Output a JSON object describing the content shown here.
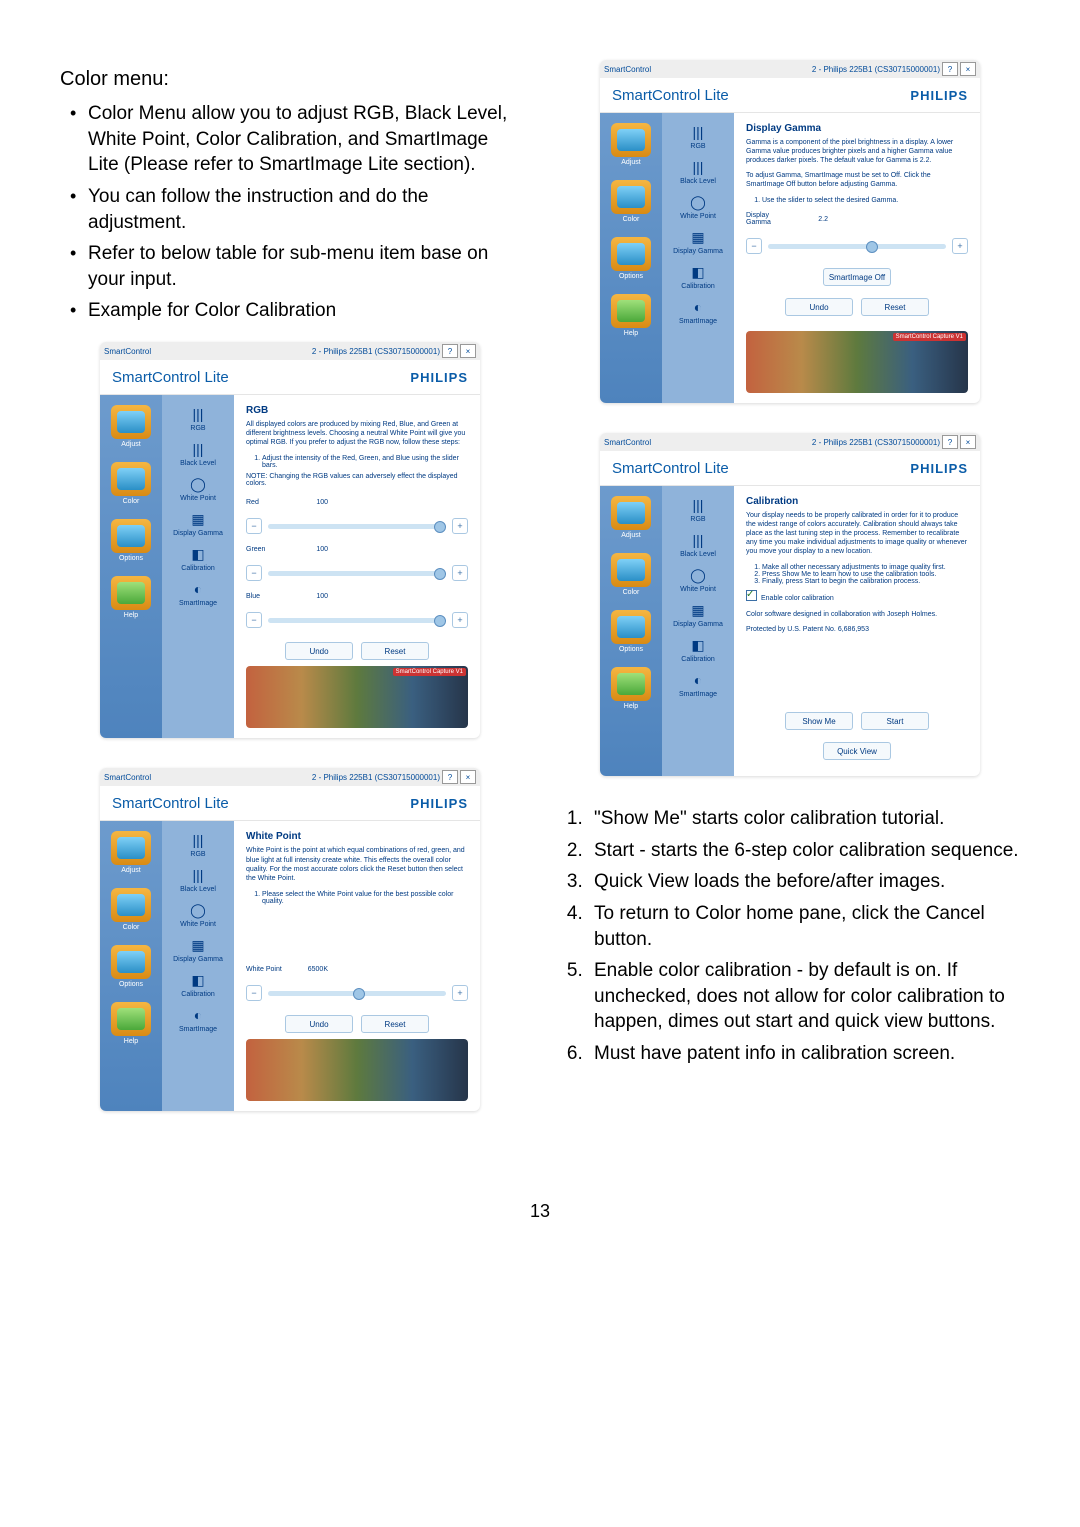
{
  "left": {
    "heading": "Color menu:",
    "bullets": [
      "Color Menu allow you to adjust RGB, Black Level, White Point, Color Calibration, and SmartImage Lite (Please refer to SmartImage Lite section).",
      "You can follow the instruction and do the adjustment.",
      "Refer to below table for sub-menu item base on your input.",
      "Example for Color Calibration"
    ]
  },
  "right_list": [
    "\"Show Me\" starts color calibration tutorial.",
    "Start - starts the 6-step color calibration sequence.",
    "Quick View loads the before/after images.",
    "To return to Color home pane, click the Cancel button.",
    "Enable color calibration - by default is on. If unchecked, does not allow for color calibration to happen, dimes out start and quick view buttons.",
    "Must have patent info in calibration screen."
  ],
  "page_number": "13",
  "common": {
    "titlebar_app": "SmartControl",
    "titlebar_right": "2 - Philips 225B1 (CS30715000001)",
    "help_btn": "?",
    "close_btn": "×",
    "brand_app": "SmartControl Lite",
    "brand_logo": "PHILIPS",
    "sidebar": [
      "Adjust",
      "Color",
      "Options",
      "Help"
    ],
    "submenu": [
      "RGB",
      "Black Level",
      "White Point",
      "Display Gamma",
      "Calibration",
      "SmartImage"
    ],
    "submenu_icons": [
      "|||",
      "|||",
      "◯",
      "▦",
      "◧",
      "◐"
    ],
    "undo": "Undo",
    "reset": "Reset",
    "preview_badge": "SmartControl Capture V1"
  },
  "win_rgb": {
    "title": "RGB",
    "desc": "All displayed colors are produced by mixing Red, Blue, and Green at different brightness levels. Choosing a neutral White Point will give you optimal RGB. If you prefer to adjust the RGB now, follow these steps:",
    "step": "Adjust the intensity of the Red, Green, and Blue using the slider bars.",
    "note": "NOTE: Changing the RGB values can adversely effect the displayed colors.",
    "red": "Red",
    "green": "Green",
    "blue": "Blue",
    "val": "100"
  },
  "win_wp": {
    "title": "White Point",
    "desc": "White Point is the point at which equal combinations of red, green, and blue light at full intensity create white. This effects the overall color quality. For the most accurate colors click the Reset button then select the White Point.",
    "step": "Please select the White Point value for the best possible color quality.",
    "label": "White Point",
    "val": "6500K"
  },
  "win_gamma": {
    "title": "Display Gamma",
    "desc": "Gamma is a component of the pixel brightness in a display. A lower Gamma value produces brighter pixels and a higher Gamma value produces darker pixels. The default value for Gamma is 2.2.",
    "desc2": "To adjust Gamma, SmartImage must be set to Off. Click the SmartImage Off button before adjusting Gamma.",
    "step": "Use the slider to select the desired Gamma.",
    "label": "Display Gamma",
    "val": "2.2",
    "si_off": "SmartImage Off"
  },
  "win_cal": {
    "title": "Calibration",
    "desc": "Your display needs to be properly calibrated in order for it to produce the widest range of colors accurately. Calibration should always take place as the last tuning step in the process. Remember to recalibrate any time you make individual adjustments to image quality or whenever you move your display to a new location.",
    "steps": [
      "Make all other necessary adjustments to image quality first.",
      "Press Show Me to learn how to use the calibration tools.",
      "Finally, press Start to begin the calibration process."
    ],
    "enable": "Enable color calibration",
    "credit": "Color software designed in collaboration with Joseph Holmes.",
    "patent": "Protected by U.S. Patent No. 6,686,953",
    "show_me": "Show Me",
    "start": "Start",
    "quick_view": "Quick View"
  }
}
